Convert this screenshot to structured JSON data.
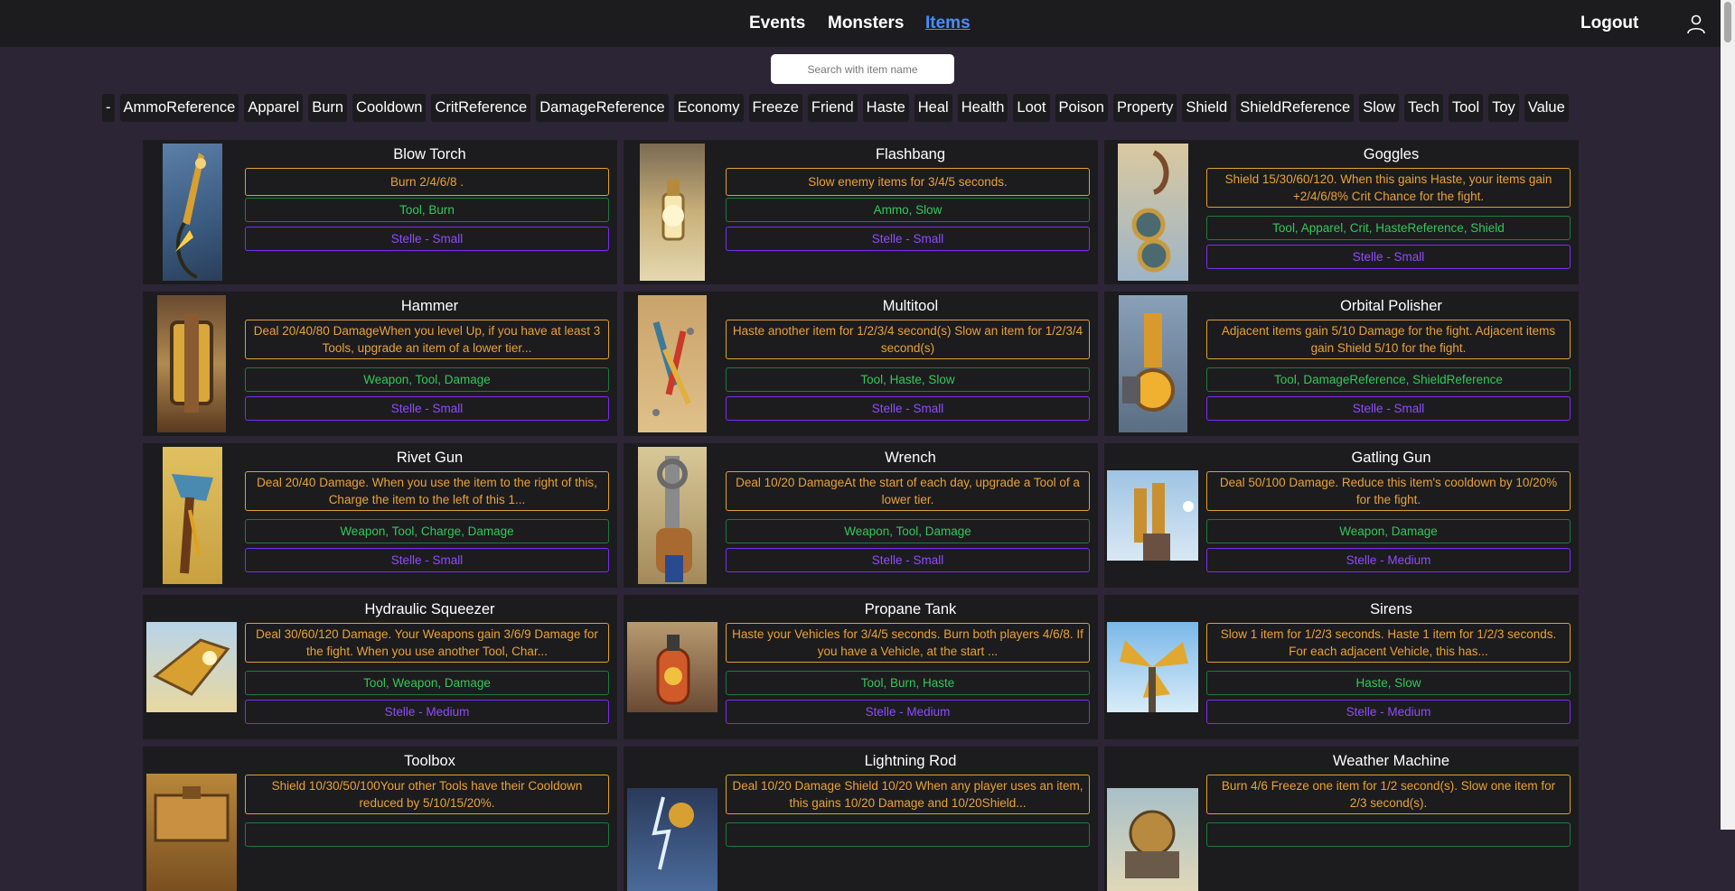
{
  "nav": {
    "events": "Events",
    "monsters": "Monsters",
    "items": "Items",
    "logout": "Logout"
  },
  "search": {
    "placeholder": "Search with item name"
  },
  "filters": [
    "-",
    "AmmoReference",
    "Apparel",
    "Burn",
    "Cooldown",
    "CritReference",
    "DamageReference",
    "Economy",
    "Freeze",
    "Friend",
    "Haste",
    "Heal",
    "Health",
    "Loot",
    "Poison",
    "Property",
    "Shield",
    "ShieldReference",
    "Slow",
    "Tech",
    "Tool",
    "Toy",
    "Value"
  ],
  "items": [
    {
      "name": "Blow Torch",
      "description": "Burn 2/4/6/8 .",
      "tags": "Tool, Burn",
      "source": "Stelle - Small"
    },
    {
      "name": "Flashbang",
      "description": "Slow enemy items for 3/4/5 seconds.",
      "tags": "Ammo, Slow",
      "source": "Stelle - Small"
    },
    {
      "name": "Goggles",
      "description": "Shield 15/30/60/120. When this gains Haste, your items gain +2/4/6/8% Crit Chance for the fight.",
      "tags": "Tool, Apparel, Crit, HasteReference, Shield",
      "source": "Stelle - Small"
    },
    {
      "name": "Hammer",
      "description": "Deal 20/40/80 DamageWhen you level Up, if you have at least 3 Tools, upgrade an item of a lower tier...",
      "tags": "Weapon, Tool, Damage",
      "source": "Stelle - Small"
    },
    {
      "name": "Multitool",
      "description": "Haste another item for 1/2/3/4 second(s) Slow an item for 1/2/3/4 second(s)",
      "tags": "Tool, Haste, Slow",
      "source": "Stelle - Small"
    },
    {
      "name": "Orbital Polisher",
      "description": "Adjacent items gain 5/10 Damage for the fight. Adjacent items gain Shield 5/10 for the fight.",
      "tags": "Tool, DamageReference, ShieldReference",
      "source": "Stelle - Small"
    },
    {
      "name": "Rivet Gun",
      "description": "Deal 20/40 Damage. When you use the item to the right of this, Charge the item to the left of this 1...",
      "tags": "Weapon, Tool, Charge, Damage",
      "source": "Stelle - Small"
    },
    {
      "name": "Wrench",
      "description": "Deal 10/20 DamageAt the start of each day, upgrade a Tool of a lower tier.",
      "tags": "Weapon, Tool, Damage",
      "source": "Stelle - Small"
    },
    {
      "name": "Gatling Gun",
      "description": "Deal 50/100 Damage. Reduce this item's cooldown by 10/20% for the fight.",
      "tags": "Weapon, Damage",
      "source": "Stelle - Medium"
    },
    {
      "name": "Hydraulic Squeezer",
      "description": "Deal 30/60/120 Damage. Your Weapons gain 3/6/9 Damage for the fight. When you use another Tool, Char...",
      "tags": "Tool, Weapon, Damage",
      "source": "Stelle - Medium"
    },
    {
      "name": "Propane Tank",
      "description": "Haste your Vehicles for 3/4/5 seconds. Burn both players 4/6/8. If you have a Vehicle, at the start ...",
      "tags": "Tool, Burn, Haste",
      "source": "Stelle - Medium"
    },
    {
      "name": "Sirens",
      "description": "Slow 1 item for 1/2/3 seconds. Haste 1 item for 1/2/3 seconds. For each adjacent Vehicle, this has...",
      "tags": "Haste, Slow",
      "source": "Stelle - Medium"
    },
    {
      "name": "Toolbox",
      "description": "Shield 10/30/50/100Your other Tools have their Cooldown reduced by 5/10/15/20%.",
      "tags": "",
      "source": ""
    },
    {
      "name": "Lightning Rod",
      "description": "Deal 10/20 Damage Shield 10/20 When any player uses an item, this gains 10/20 Damage and 10/20Shield...",
      "tags": "",
      "source": ""
    },
    {
      "name": "Weather Machine",
      "description": "Burn 4/6 Freeze one item for 1/2 second(s). Slow one item for 2/3 second(s).",
      "tags": "",
      "source": ""
    }
  ],
  "colors": {
    "background": "#2b2536",
    "panel": "#1c1c1e",
    "active_nav": "#4b8dff",
    "description": "#e8a23a",
    "tags": "#34c759",
    "source": "#8f4bff"
  }
}
